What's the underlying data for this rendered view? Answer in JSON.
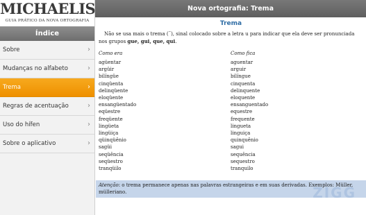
{
  "logo": {
    "main": "MICHAELIS",
    "sub": "GUIA PRÁTICO DA NOVA ORTOGRAFIA"
  },
  "sidebar": {
    "header": "Índice",
    "items": [
      {
        "label": "Sobre",
        "active": false
      },
      {
        "label": "Mudanças no alfabeto",
        "active": false
      },
      {
        "label": "Trema",
        "active": true
      },
      {
        "label": "Regras de acentuação",
        "active": false
      },
      {
        "label": "Uso do hífen",
        "active": false
      },
      {
        "label": "Sobre o aplicativo",
        "active": false
      }
    ],
    "chevron": "›"
  },
  "topbar": {
    "title": "Nova ortografia: Trema"
  },
  "content": {
    "heading": "Trema",
    "intro_pre": "Não se usa mais o trema (¨), sinal colocado sobre a letra u para indicar que ela deve ser pronunciada nos grupos ",
    "intro_groups": "gue, gui, que, qui",
    "intro_post": ".",
    "col_left_head": "Como era",
    "col_right_head": "Como fica",
    "left_words": [
      "agüentar",
      "argüir",
      "bilíngüe",
      "cinqüenta",
      "delinqüente",
      "eloqüente",
      "ensangüentado",
      "eqüestre",
      "freqüente",
      "lingüeta",
      "lingüiça",
      "qüinqüênio",
      "sagüi",
      "seqüência",
      "seqüestro",
      "tranqüilo"
    ],
    "right_words": [
      "aguentar",
      "arguir",
      "bilíngue",
      "cinquenta",
      "delinquente",
      "eloquente",
      "ensanguentado",
      "equestre",
      "frequente",
      "lingueta",
      "linguiça",
      "quinquênio",
      "sagui",
      "sequência",
      "sequestro",
      "tranquilo"
    ],
    "note_label": "Atenção",
    "note_text": ": o trema permanece apenas nas palavras estrangeiras e em suas derivadas. Exemplos: Müller, mülleriano."
  },
  "watermark": "ZIGG"
}
